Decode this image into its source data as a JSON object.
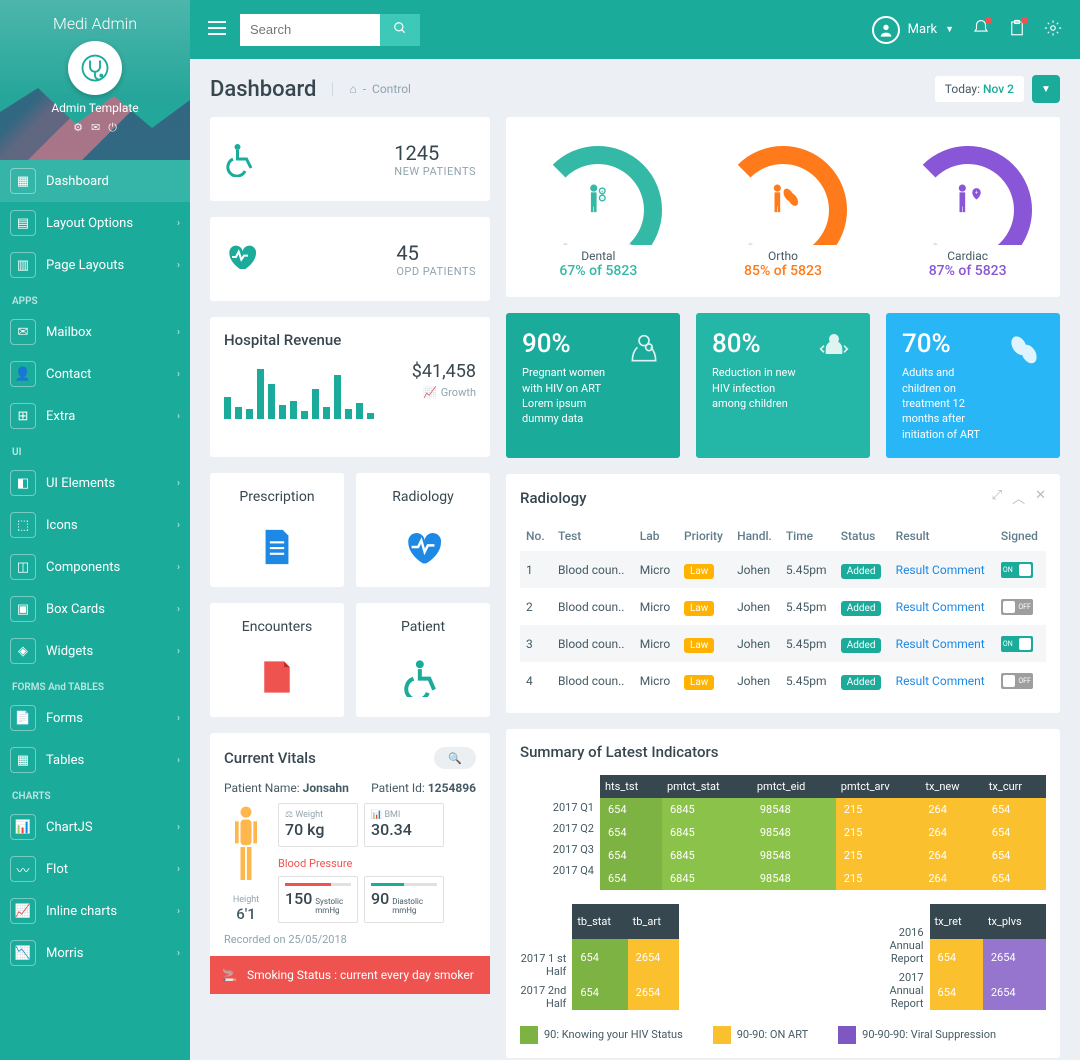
{
  "brand": {
    "a": "Medi",
    "b": "Admin"
  },
  "avatar_title": "Admin Template",
  "nav": {
    "main": [
      "Dashboard",
      "Layout Options",
      "Page Layouts"
    ],
    "sections": {
      "apps": {
        "title": "APPS",
        "items": [
          "Mailbox",
          "Contact",
          "Extra"
        ]
      },
      "ui": {
        "title": "UI",
        "items": [
          "UI Elements",
          "Icons",
          "Components",
          "Box Cards",
          "Widgets"
        ]
      },
      "forms": {
        "title": "FORMS And TABLES",
        "items": [
          "Forms",
          "Tables"
        ]
      },
      "charts": {
        "title": "CHARTS",
        "items": [
          "ChartJS",
          "Flot",
          "Inline charts",
          "Morris"
        ]
      }
    }
  },
  "search_placeholder": "Search",
  "user_name": "Mark",
  "page_title": "Dashboard",
  "breadcrumb": "Control",
  "date": {
    "label": "Today:",
    "value": "Nov 2"
  },
  "stats": [
    {
      "value": "1245",
      "label": "NEW PATIENTS"
    },
    {
      "value": "45",
      "label": "OPD PATIENTS"
    }
  ],
  "gauges": [
    {
      "name": "Dental",
      "pct": 67,
      "total": 5823,
      "color": "#33b9a5"
    },
    {
      "name": "Ortho",
      "pct": 85,
      "total": 5823,
      "color": "#ff7a1a"
    },
    {
      "name": "Cardiac",
      "pct": 87,
      "total": 5823,
      "color": "#8856d6"
    }
  ],
  "revenue": {
    "title": "Hospital Revenue",
    "amount": "$41,458",
    "growth": "Growth",
    "bars": [
      22,
      12,
      10,
      50,
      35,
      14,
      18,
      8,
      30,
      12,
      44,
      10,
      16,
      6
    ]
  },
  "tiles": [
    {
      "pct": "90%",
      "desc": "Pregnant women with HIV on ART Lorem ipsum dummy data",
      "color": "#1aab9b"
    },
    {
      "pct": "80%",
      "desc": "Reduction in new HIV infection among children",
      "color": "#24b6a7"
    },
    {
      "pct": "70%",
      "desc": "Adults and children on treatment 12 months after initiation of ART",
      "color": "#29b6f6"
    }
  ],
  "minis": [
    {
      "title": "Prescription",
      "color": "#1e88e5"
    },
    {
      "title": "Radiology",
      "color": "#1e88e5"
    },
    {
      "title": "Encounters",
      "color": "#ef5350"
    },
    {
      "title": "Patient",
      "color": "#1aab9b"
    }
  ],
  "radiology": {
    "title": "Radiology",
    "cols": [
      "No.",
      "Test",
      "Lab",
      "Priority",
      "Handl.",
      "Time",
      "Status",
      "Result",
      "Signed"
    ],
    "rows": [
      {
        "no": "1",
        "test": "Blood coun..",
        "lab": "Micro",
        "priority": "Law",
        "handl": "Johen",
        "time": "5.45pm",
        "status": "Added",
        "result": "Result Comment",
        "signed": true
      },
      {
        "no": "2",
        "test": "Blood coun..",
        "lab": "Micro",
        "priority": "Law",
        "handl": "Johen",
        "time": "5.45pm",
        "status": "Added",
        "result": "Result Comment",
        "signed": false
      },
      {
        "no": "3",
        "test": "Blood coun..",
        "lab": "Micro",
        "priority": "Law",
        "handl": "Johen",
        "time": "5.45pm",
        "status": "Added",
        "result": "Result Comment",
        "signed": true
      },
      {
        "no": "4",
        "test": "Blood coun..",
        "lab": "Micro",
        "priority": "Law",
        "handl": "Johen",
        "time": "5.45pm",
        "status": "Added",
        "result": "Result Comment",
        "signed": false
      }
    ]
  },
  "vitals": {
    "title": "Current Vitals",
    "patient_name_label": "Patient Name:",
    "patient_name": "Jonsahn",
    "patient_id_label": "Patient Id:",
    "patient_id": "1254896",
    "height_label": "Height",
    "height": "6'1",
    "weight_label": "Weight",
    "weight": "70 kg",
    "bmi_label": "BMI",
    "bmi": "30.34",
    "bp_title": "Blood Pressure",
    "systolic_label": "Systolic",
    "systolic": "150",
    "systolic_unit": "mmHg",
    "diastolic_label": "Diastolic",
    "diastolic": "90",
    "diastolic_unit": "mmHg",
    "recorded": "Recorded on 25/05/2018",
    "smoking": "Smoking Status : current every day smoker"
  },
  "indicators": {
    "title": "Summary of Latest Indicators",
    "head1": [
      "hts_tst",
      "pmtct_stat",
      "pmtct_eid",
      "pmtct_arv",
      "tx_new",
      "tx_curr"
    ],
    "quarters": [
      "2017 Q1",
      "2017 Q2",
      "2017 Q3",
      "2017 Q4"
    ],
    "data": [
      [
        "654",
        "6845",
        "98548",
        "215",
        "264",
        "654"
      ],
      [
        "654",
        "6845",
        "98548",
        "215",
        "264",
        "654"
      ],
      [
        "654",
        "6845",
        "98548",
        "215",
        "264",
        "654"
      ],
      [
        "654",
        "6845",
        "98548",
        "215",
        "264",
        "654"
      ]
    ],
    "colClass": [
      "g1",
      "g2",
      "g2",
      "y1",
      "y1",
      "y1"
    ],
    "half_labels": [
      "2017 1 st Half",
      "2017 2nd Half"
    ],
    "head2a": [
      "tb_stat",
      "tb_art"
    ],
    "head2b": [
      "tx_ret",
      "tx_plvs"
    ],
    "half_data_a": [
      [
        "654",
        "2654"
      ],
      [
        "654",
        "2654"
      ]
    ],
    "half_data_b": [
      [
        "654",
        "2654"
      ],
      [
        "654",
        "2654"
      ]
    ],
    "reports": [
      "2016 Annual Report",
      "2017 Annual Report"
    ],
    "legend": [
      {
        "c": "#7cb342",
        "t": "90: Knowing your HIV Status"
      },
      {
        "c": "#fbc02d",
        "t": "90-90: ON ART"
      },
      {
        "c": "#7e57c2",
        "t": "90-90-90: Viral Suppression"
      }
    ]
  },
  "chart_data": {
    "gauges": [
      {
        "name": "Dental",
        "pct": 67,
        "total": 5823
      },
      {
        "name": "Ortho",
        "pct": 85,
        "total": 5823
      },
      {
        "name": "Cardiac",
        "pct": 87,
        "total": 5823
      }
    ],
    "revenue_bars": {
      "type": "bar",
      "values": [
        22,
        12,
        10,
        50,
        35,
        14,
        18,
        8,
        30,
        12,
        44,
        10,
        16,
        6
      ],
      "ylabel": "",
      "title": "Hospital Revenue"
    }
  }
}
